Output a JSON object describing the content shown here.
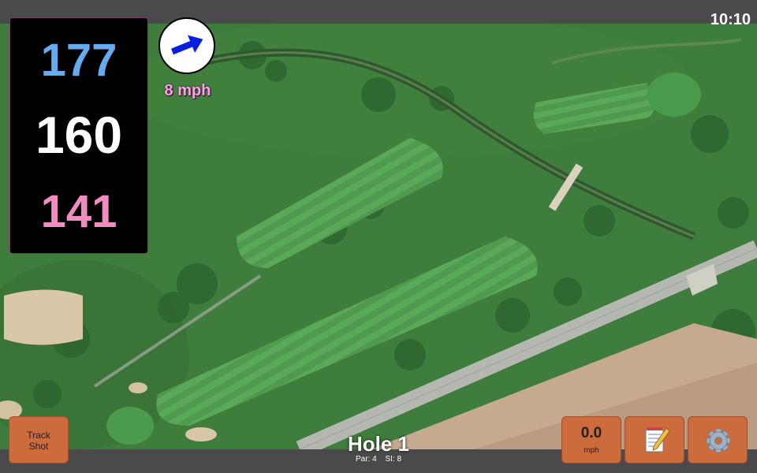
{
  "status_bar": {
    "time": "10:10"
  },
  "distances": {
    "back": "177",
    "middle": "160",
    "front": "141"
  },
  "wind": {
    "speed_label": "8 mph",
    "direction_icon": "arrow-icon",
    "arrow_color": "#0a1ee0"
  },
  "buttons": {
    "track_shot_line1": "Track",
    "track_shot_line2": "Shot",
    "speed_value": "0.0",
    "speed_unit": "mph",
    "notes_icon": "notepad-icon",
    "settings_icon": "gear-icon"
  },
  "hole": {
    "title": "Hole 1",
    "par": "Par: 4",
    "si": "SI: 8"
  },
  "colors": {
    "back": "#66aaf0",
    "middle": "#ffffff",
    "front": "#f08cc0",
    "button": "#cc6b3c",
    "bar": "#4a4a4a"
  }
}
